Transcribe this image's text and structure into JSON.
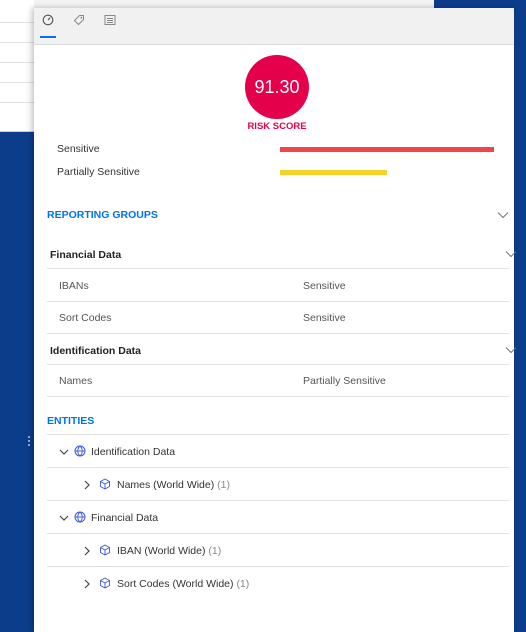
{
  "tabs": [
    {
      "name": "risk-tab",
      "icon": "gauge-icon",
      "active": true
    },
    {
      "name": "tags-tab",
      "icon": "tag-icon",
      "active": false
    },
    {
      "name": "details-tab",
      "icon": "list-icon",
      "active": false
    }
  ],
  "risk": {
    "score": "91.30",
    "label": "RISK SCORE",
    "color": "#e5004c",
    "bars": [
      {
        "label": "Sensitive",
        "fraction": 1.0,
        "color": "#f0434a"
      },
      {
        "label": "Partially Sensitive",
        "fraction": 0.5,
        "color": "#f6d12a"
      }
    ]
  },
  "reporting_groups": {
    "title": "REPORTING GROUPS",
    "groups": [
      {
        "name": "Financial Data",
        "rows": [
          {
            "label": "IBANs",
            "value": "Sensitive"
          },
          {
            "label": "Sort Codes",
            "value": "Sensitive"
          }
        ]
      },
      {
        "name": "Identification Data",
        "rows": [
          {
            "label": "Names",
            "value": "Partially Sensitive"
          }
        ]
      }
    ]
  },
  "entities": {
    "title": "ENTITIES",
    "items": [
      {
        "label": "Identification Data",
        "count": "",
        "level": 1,
        "expanded": true,
        "icon": "globe-icon"
      },
      {
        "label": "Names (World Wide)",
        "count": "(1)",
        "level": 2,
        "expanded": false,
        "icon": "cube-icon"
      },
      {
        "label": "Financial Data",
        "count": "",
        "level": 1,
        "expanded": true,
        "icon": "globe-icon"
      },
      {
        "label": "IBAN (World Wide)",
        "count": "(1)",
        "level": 2,
        "expanded": false,
        "icon": "cube-icon"
      },
      {
        "label": "Sort Codes (World Wide)",
        "count": "(1)",
        "level": 2,
        "expanded": false,
        "icon": "cube-icon"
      }
    ]
  },
  "colors": {
    "accent": "#0073e7",
    "background": "#0c3d8a"
  }
}
